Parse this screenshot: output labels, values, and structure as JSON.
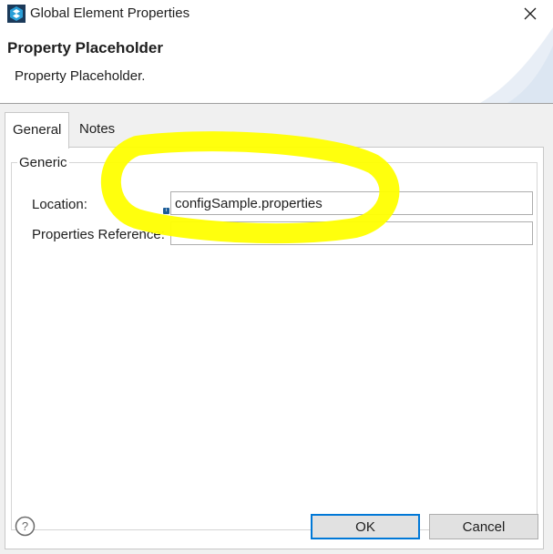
{
  "window": {
    "title": "Global Element Properties",
    "icon": "mule-studio-icon",
    "close_icon": "close-icon"
  },
  "banner": {
    "title": "Property Placeholder",
    "description": "Property Placeholder."
  },
  "tabs": [
    {
      "label": "General",
      "active": true
    },
    {
      "label": "Notes",
      "active": false
    }
  ],
  "group": {
    "label": "Generic"
  },
  "fields": {
    "location": {
      "label": "Location:",
      "value": "configSample.properties",
      "placeholder": ""
    },
    "properties_reference": {
      "label": "Properties Reference:",
      "value": "",
      "placeholder": ""
    }
  },
  "footer": {
    "help_icon": "help-icon",
    "ok_label": "OK",
    "cancel_label": "Cancel"
  },
  "colors": {
    "accent": "#0078d7",
    "highlight": "#ffff00"
  }
}
